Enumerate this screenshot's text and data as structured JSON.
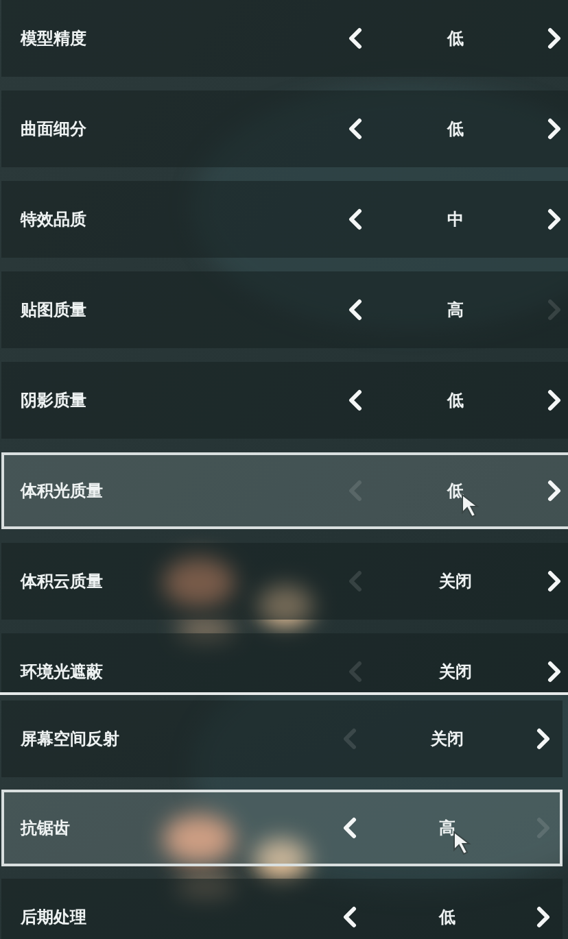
{
  "panels": [
    {
      "rows": [
        {
          "label": "模型精度",
          "value": "低",
          "prev_enabled": true,
          "next_enabled": true,
          "selected": false,
          "cursor": false
        },
        {
          "label": "曲面细分",
          "value": "低",
          "prev_enabled": true,
          "next_enabled": true,
          "selected": false,
          "cursor": false
        },
        {
          "label": "特效品质",
          "value": "中",
          "prev_enabled": true,
          "next_enabled": true,
          "selected": false,
          "cursor": false
        },
        {
          "label": "贴图质量",
          "value": "高",
          "prev_enabled": true,
          "next_enabled": false,
          "selected": false,
          "cursor": false
        },
        {
          "label": "阴影质量",
          "value": "低",
          "prev_enabled": true,
          "next_enabled": true,
          "selected": false,
          "cursor": false
        },
        {
          "label": "体积光质量",
          "value": "低",
          "prev_enabled": false,
          "next_enabled": true,
          "selected": true,
          "cursor": true
        },
        {
          "label": "体积云质量",
          "value": "关闭",
          "prev_enabled": false,
          "next_enabled": true,
          "selected": false,
          "cursor": false
        },
        {
          "label": "环境光遮蔽",
          "value": "关闭",
          "prev_enabled": false,
          "next_enabled": true,
          "selected": false,
          "cursor": false
        }
      ]
    },
    {
      "rows": [
        {
          "label": "屏幕空间反射",
          "value": "关闭",
          "prev_enabled": false,
          "next_enabled": true,
          "selected": false,
          "cursor": false
        },
        {
          "label": "抗锯齿",
          "value": "高",
          "prev_enabled": true,
          "next_enabled": false,
          "selected": true,
          "cursor": true
        },
        {
          "label": "后期处理",
          "value": "低",
          "prev_enabled": true,
          "next_enabled": true,
          "selected": false,
          "cursor": false
        }
      ]
    }
  ]
}
